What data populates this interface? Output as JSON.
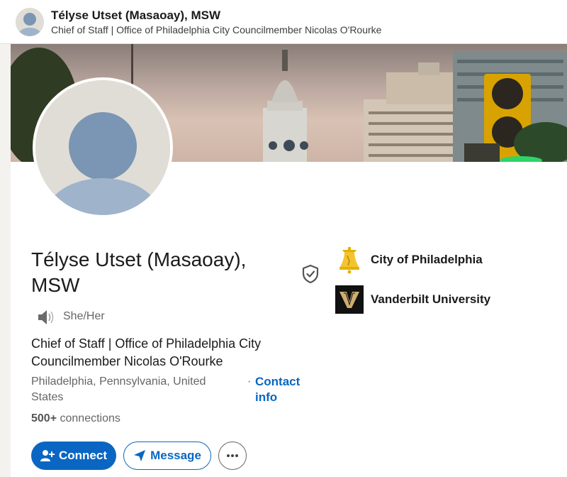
{
  "header": {
    "name": "Télyse Utset (Masaoay), MSW",
    "headline": "Chief of Staff | Office of Philadelphia City Councilmember Nicolas O'Rourke"
  },
  "profile": {
    "name": "Télyse Utset (Masaoay), MSW",
    "pronouns": "She/Her",
    "headline": "Chief of Staff | Office of Philadelphia City Councilmember Nicolas O'Rourke",
    "location": "Philadelphia, Pennsylvania, United States",
    "location_separator": "·",
    "contact_info_label": "Contact info",
    "connections_count": "500+",
    "connections_label": "connections"
  },
  "actions": {
    "connect_label": "Connect",
    "message_label": "Message",
    "more_label": "More actions"
  },
  "organizations": [
    {
      "name": "City of Philadelphia",
      "logo": "liberty-bell-logo"
    },
    {
      "name": "Vanderbilt University",
      "logo": "vanderbilt-v-logo"
    }
  ],
  "colors": {
    "primary": "#0a66c2",
    "text": "#1a1a1a",
    "muted": "#666666",
    "bell_gold": "#f4c430",
    "vanderbilt_gold": "#cfae70"
  }
}
